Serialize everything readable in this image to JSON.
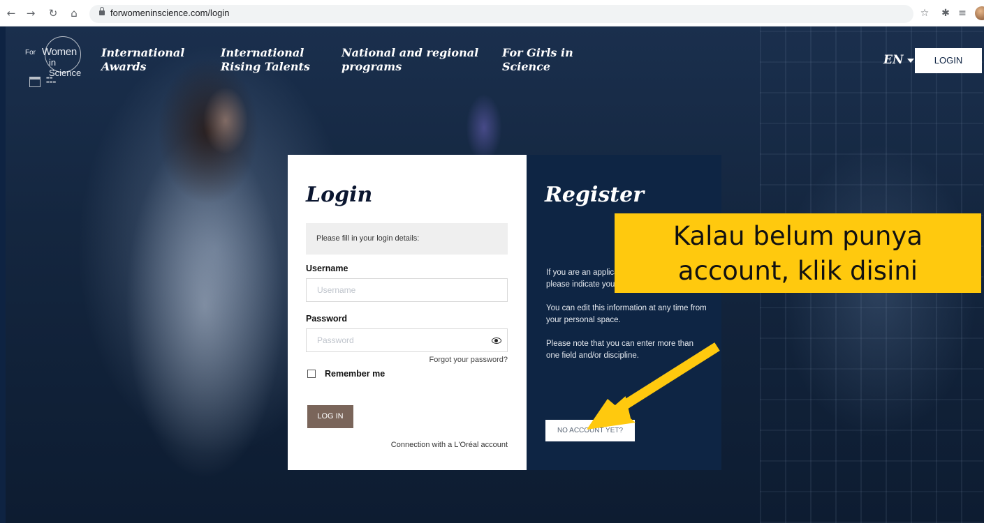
{
  "browser": {
    "url": "forwomeninscience.com/login",
    "nav_icons": [
      "back-arrow-icon",
      "forward-arrow-icon",
      "reload-icon",
      "home-icon"
    ],
    "extension_icons": [
      "star-icon",
      "puzzle-icon",
      "playlist-icon"
    ]
  },
  "site": {
    "logo": {
      "line1": "For",
      "line2": "Women",
      "line3": "in Science"
    },
    "menu": [
      {
        "line1": "International",
        "line2": "Awards"
      },
      {
        "line1": "International",
        "line2": "Rising Talents"
      },
      {
        "line1": "National and regional",
        "line2": "programs"
      },
      {
        "line1": "For Girls in",
        "line2": "Science"
      }
    ],
    "language": "EN",
    "login_button": "LOGIN"
  },
  "login": {
    "title": "Login",
    "hint": "Please fill in your login details:",
    "username_label": "Username",
    "username_placeholder": "Username",
    "password_label": "Password",
    "password_placeholder": "Password",
    "forgot": "Forgot your password?",
    "remember": "Remember me",
    "submit": "LOG IN",
    "loreal": "Connection with a L'Oréal account"
  },
  "register": {
    "title": "Register",
    "para1": "If you are an applicant or an evaluator, please indicate your expertise.",
    "para2": "You can edit this information at any time from your personal space.",
    "para3": "Please note that you can enter more than one field and/or discipline.",
    "button": "NO ACCOUNT YET?"
  },
  "annotation": {
    "line1": "Kalau belum punya",
    "line2": "account, klik disini",
    "color": "#ffc90e"
  }
}
